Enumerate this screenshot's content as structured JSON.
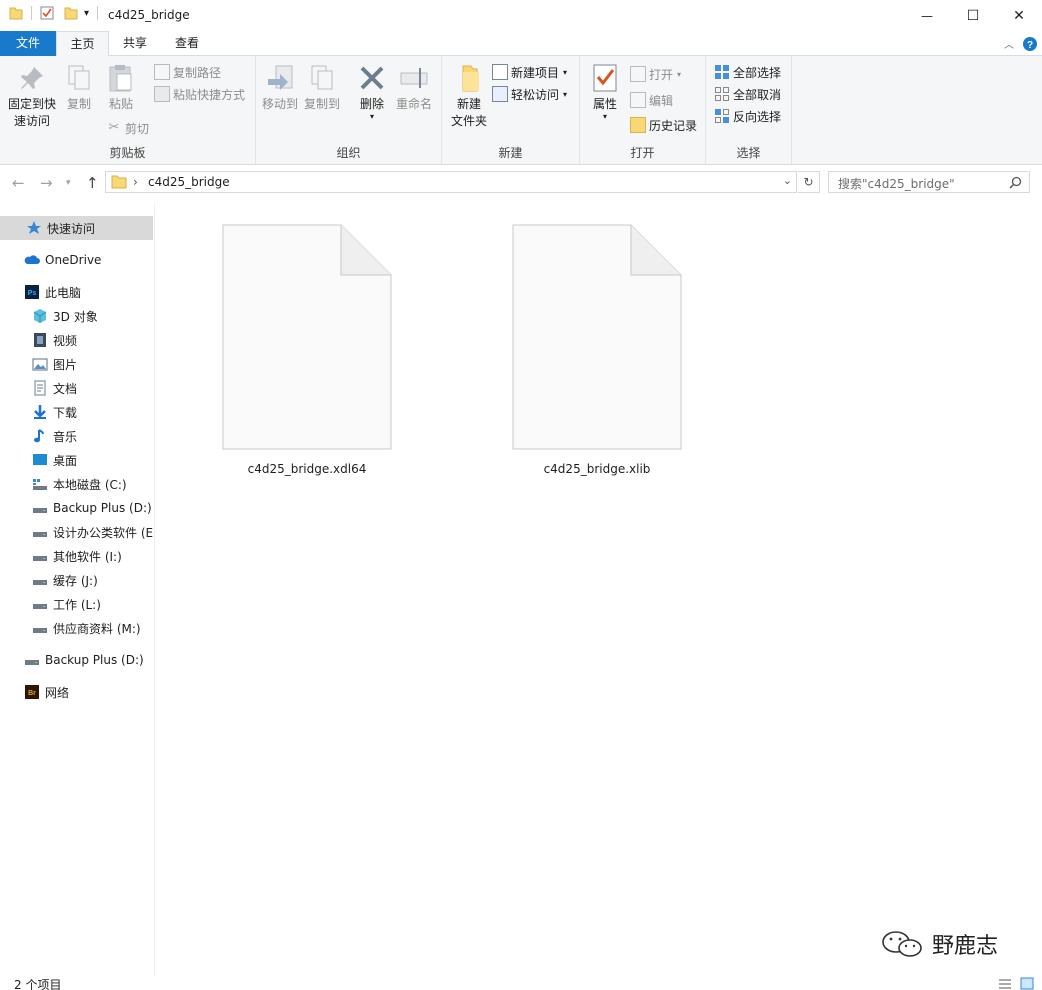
{
  "window": {
    "title": "c4d25_bridge",
    "minimize_glyph": "—",
    "maximize_glyph": "☐",
    "close_glyph": "✕"
  },
  "ribbon_tabs": {
    "file": "文件",
    "home": "主页",
    "share": "共享",
    "view": "查看"
  },
  "ribbon": {
    "clipboard": {
      "label": "剪贴板",
      "pin_line1": "固定到快",
      "pin_line2": "速访问",
      "copy": "复制",
      "paste": "粘贴",
      "copy_path": "复制路径",
      "paste_shortcut": "粘贴快捷方式",
      "cut": "剪切"
    },
    "organize": {
      "label": "组织",
      "move_to": "移动到",
      "copy_to": "复制到",
      "delete": "删除",
      "rename": "重命名"
    },
    "new": {
      "label": "新建",
      "new_folder_line1": "新建",
      "new_folder_line2": "文件夹",
      "new_item": "新建项目",
      "easy_access": "轻松访问"
    },
    "open": {
      "label": "打开",
      "properties": "属性",
      "open": "打开",
      "edit": "编辑",
      "history": "历史记录"
    },
    "select": {
      "label": "选择",
      "select_all": "全部选择",
      "select_none": "全部取消",
      "invert": "反向选择"
    }
  },
  "address": {
    "path": "c4d25_bridge",
    "separator": "›",
    "search_placeholder": "搜索\"c4d25_bridge\""
  },
  "nav_pane": {
    "quick_access": "快速访问",
    "onedrive": "OneDrive",
    "this_pc": "此电脑",
    "items": [
      "3D 对象",
      "视频",
      "图片",
      "文档",
      "下载",
      "音乐",
      "桌面",
      "本地磁盘 (C:)",
      "Backup Plus (D:)",
      "设计办公类软件 (E",
      "其他软件 (I:)",
      "缓存 (J:)",
      "工作 (L:)",
      "供应商资料 (M:)"
    ],
    "backup_plus": "Backup Plus (D:)",
    "network": "网络"
  },
  "files": [
    {
      "name": "c4d25_bridge.xdl64"
    },
    {
      "name": "c4d25_bridge.xlib"
    }
  ],
  "status": {
    "count": "2 个项目"
  },
  "watermark": {
    "text": "野鹿志"
  },
  "colors": {
    "file_tab": "#1979ca",
    "ribbon_bg": "#f5f6f7",
    "selected_nav": "#d9d9d9",
    "help": "#1979ca",
    "folder": "#f8d775"
  }
}
